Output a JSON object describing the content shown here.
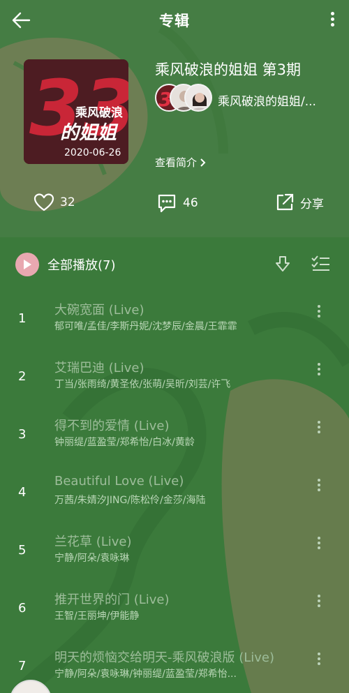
{
  "header": {
    "title": "专辑",
    "back_icon": "arrow-left-icon",
    "more_icon": "more-vertical-icon"
  },
  "album": {
    "name": "乘风破浪的姐姐 第3期",
    "artists": "乘风破浪的姐姐/...",
    "intro_link": "查看简介",
    "cover": {
      "big_text": "33",
      "line1": "乘风破浪",
      "line2": "的姐姐",
      "date": "2020-06-26"
    }
  },
  "actions": {
    "like_count": "32",
    "comment_count": "46",
    "share_label": "分享"
  },
  "playlist": {
    "play_all_label": "全部播放(7)"
  },
  "tracks": [
    {
      "num": "1",
      "title": "大碗宽面 (Live)",
      "artists": "郁可唯/孟佳/李斯丹妮/沈梦辰/金晨/王霏霏"
    },
    {
      "num": "2",
      "title": "艾瑞巴迪 (Live)",
      "artists": "丁当/张雨绮/黄圣依/张萌/吴昕/刘芸/许飞"
    },
    {
      "num": "3",
      "title": "得不到的爱情 (Live)",
      "artists": "钟丽缇/蓝盈莹/郑希怡/白冰/黄龄"
    },
    {
      "num": "4",
      "title": "Beautiful Love (Live)",
      "artists": "万茜/朱婧汐JING/陈松伶/金莎/海陆"
    },
    {
      "num": "5",
      "title": "兰花草 (Live)",
      "artists": "宁静/阿朵/袁咏琳"
    },
    {
      "num": "6",
      "title": "推开世界的门 (Live)",
      "artists": "王智/王丽坤/伊能静"
    },
    {
      "num": "7",
      "title": "明天的烦恼交给明天-乘风破浪版 (Live)",
      "artists": "宁静/阿朵/袁咏琳/钟丽缇/蓝盈莹/郑希怡..."
    }
  ],
  "colors": {
    "header_bg": "#457d44",
    "list_bg": "#3b7a3b",
    "accent_pink": "#e8a8b0",
    "track_title": "#9dbd9a"
  }
}
